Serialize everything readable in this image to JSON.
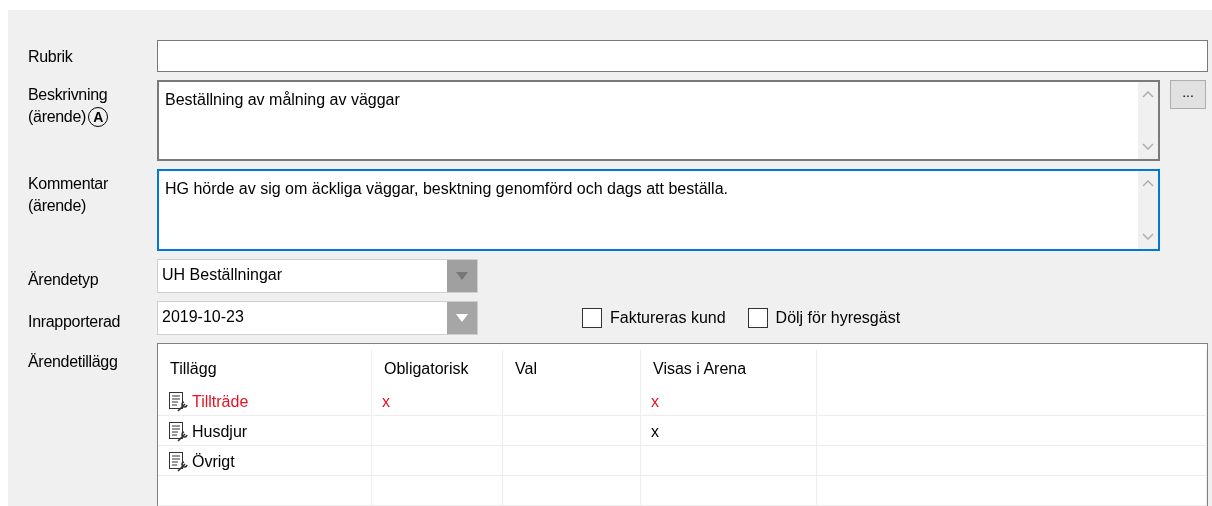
{
  "fields": [
    {
      "kind": "text",
      "label": "Rubrik"
    },
    {
      "kind": "memo",
      "label": "Beskrivning",
      "label_line2": "(ärende)",
      "badge": "A",
      "value": "Beställning av målning av väggar",
      "focused": false,
      "browse_button": "..."
    },
    {
      "kind": "memo",
      "label": "Kommentar",
      "label_line2": "(ärende)",
      "value": "HG hörde av sig om äckliga väggar, besktning genomförd och dags att beställa.",
      "focused": true
    }
  ],
  "case_type": {
    "label": "Ärendetyp",
    "value": "UH Beställningar",
    "disabled": true
  },
  "reported": {
    "label": "Inrapporterad",
    "value": "2019-10-23",
    "disabled": false
  },
  "checkboxes": [
    {
      "label": "Faktureras kund",
      "checked": false
    },
    {
      "label": "Dölj för hyresgäst",
      "checked": false
    }
  ],
  "addons": {
    "label": "Ärendetillägg",
    "columns": [
      "Tillägg",
      "Obligatorisk",
      "Val",
      "Visas i Arena"
    ],
    "rows": [
      {
        "name": "Tillträde",
        "color": "#e81123",
        "obligatorisk": "x",
        "visas": "x"
      },
      {
        "name": "Husdjur",
        "color": "#000000",
        "visas": "x"
      },
      {
        "name": "Övrigt",
        "color": "#000000"
      }
    ]
  }
}
